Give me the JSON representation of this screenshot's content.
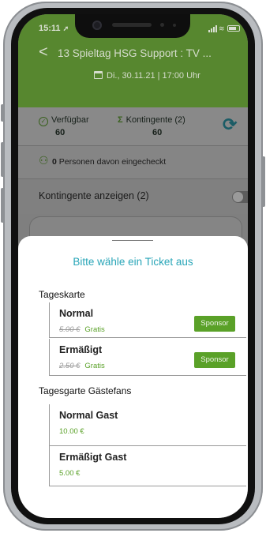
{
  "status_bar": {
    "time": "15:11",
    "location_arrow": "location-arrow-icon"
  },
  "header": {
    "back_glyph": "<",
    "title": "13 Spieltag HSG Support : TV ...",
    "date": "Di., 30.11.21 | 17:00 Uhr",
    "bg_color": "#57872f"
  },
  "stats": {
    "available_label": "Verfügbar",
    "available_value": "60",
    "quota_label": "Kontingente (2)",
    "quota_value": "60",
    "checkin_count": "0",
    "checkin_text": "Personen davon eingecheckt"
  },
  "kontingente_toggle": {
    "label": "Kontingente anzeigen (2)",
    "on": false
  },
  "sheet": {
    "title": "Bitte wähle ein Ticket aus",
    "sections": [
      {
        "title": "Tageskarte",
        "items": [
          {
            "name": "Normal",
            "old_price": "5.00 €",
            "price": "Gratis",
            "badge": "Sponsor"
          },
          {
            "name": "Ermäßigt",
            "old_price": "2.50 €",
            "price": "Gratis",
            "badge": "Sponsor"
          }
        ]
      },
      {
        "title": "Tagesgarte Gästefans",
        "items": [
          {
            "name": "Normal Gast",
            "price": "10.00 €"
          },
          {
            "name": "Ermäßigt Gast",
            "price": "5.00 €"
          }
        ]
      }
    ],
    "accent_color": "#2aa6b8",
    "sponsor_color": "#5aa128"
  }
}
